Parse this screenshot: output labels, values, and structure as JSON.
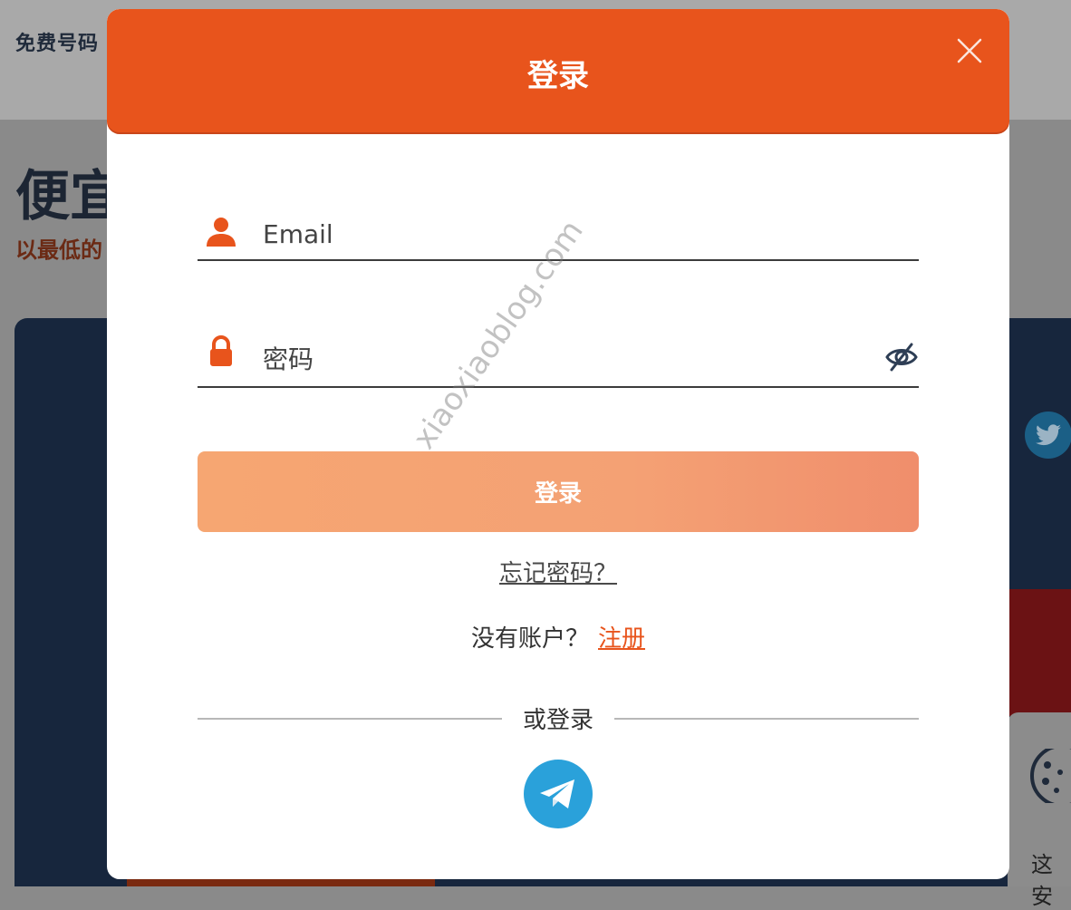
{
  "background": {
    "nav_text": "免费号码",
    "hero_title": "便宜",
    "hero_subtitle": "以最低的",
    "card_text": "这安"
  },
  "modal": {
    "title": "登录",
    "email_placeholder": "Email",
    "password_placeholder": "密码",
    "login_button": "登录",
    "forgot_password": "忘记密码？",
    "no_account_text": "没有账户？",
    "register_link": "注册",
    "or_login_text": "或登录"
  },
  "watermark": "xiaoxiaoblog.com",
  "colors": {
    "primary": "#e8541c",
    "button_gradient_start": "#f6a672",
    "button_gradient_end": "#f08e6c",
    "telegram": "#2aa1da"
  },
  "icons": {
    "close": "close-icon",
    "user": "user-icon",
    "lock": "lock-icon",
    "eye_off": "eye-off-icon",
    "telegram": "telegram-icon",
    "twitter": "twitter-icon",
    "cookie": "cookie-icon"
  }
}
